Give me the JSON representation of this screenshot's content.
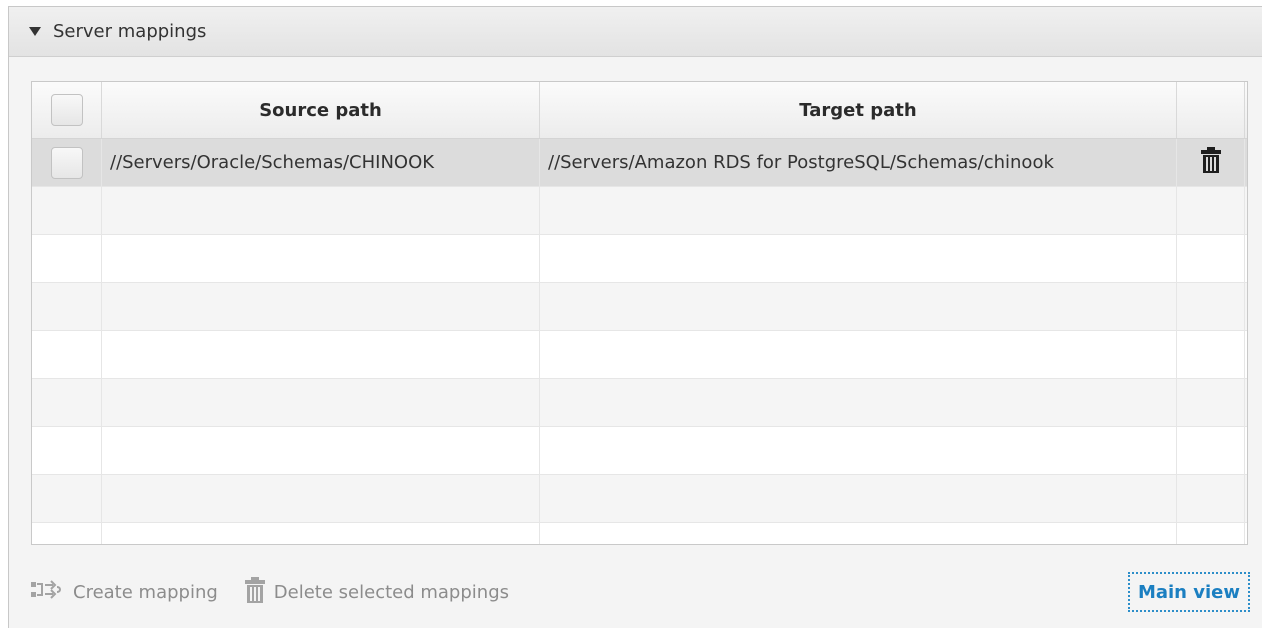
{
  "panel": {
    "title": "Server mappings",
    "collapse_icon": "triangle-down-icon"
  },
  "table": {
    "columns": {
      "select": "",
      "source": "Source path",
      "target": "Target path",
      "actions": ""
    },
    "rows": [
      {
        "source": "//Servers/Oracle/Schemas/CHINOOK",
        "target": "//Servers/Amazon RDS for PostgreSQL/Schemas/chinook",
        "action_icon": "trash-icon",
        "selected": true
      }
    ],
    "empty_row_count": 7
  },
  "footer": {
    "create_label": "Create mapping",
    "create_icon": "create-mapping-icon",
    "delete_label": "Delete selected mappings",
    "delete_icon": "trash-icon",
    "main_view_label": "Main view"
  },
  "colors": {
    "accent": "#1b7fc1",
    "disabled_text": "#8c8c8c",
    "selected_row": "#dcdcdc"
  }
}
